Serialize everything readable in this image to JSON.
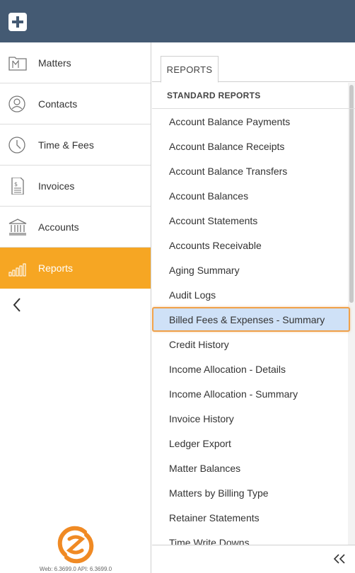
{
  "nav": {
    "items": [
      {
        "label": "Matters",
        "icon": "folder-icon"
      },
      {
        "label": "Contacts",
        "icon": "person-icon"
      },
      {
        "label": "Time & Fees",
        "icon": "clock-icon"
      },
      {
        "label": "Invoices",
        "icon": "invoice-icon"
      },
      {
        "label": "Accounts",
        "icon": "bank-icon"
      },
      {
        "label": "Reports",
        "icon": "bar-chart-icon",
        "active": true
      }
    ],
    "active_color": "#f6a623"
  },
  "topbar": {
    "color": "#445a73",
    "add_icon": "plus-icon"
  },
  "tab": {
    "label": "REPORTS"
  },
  "section": {
    "title": "STANDARD REPORTS"
  },
  "reports": [
    "Account Balance Payments",
    "Account Balance Receipts",
    "Account Balance Transfers",
    "Account Balances",
    "Account Statements",
    "Accounts Receivable",
    "Aging Summary",
    "Audit Logs",
    "Billed Fees & Expenses - Summary",
    "Credit History",
    "Income Allocation - Details",
    "Income Allocation - Summary",
    "Invoice History",
    "Ledger Export",
    "Matter Balances",
    "Matters by Billing Type",
    "Retainer Statements",
    "Time Write Downs"
  ],
  "selected_report": "Billed Fees & Expenses - Summary",
  "footer": {
    "version": "Web: 6.3699.0 API: 6.3699.0"
  }
}
